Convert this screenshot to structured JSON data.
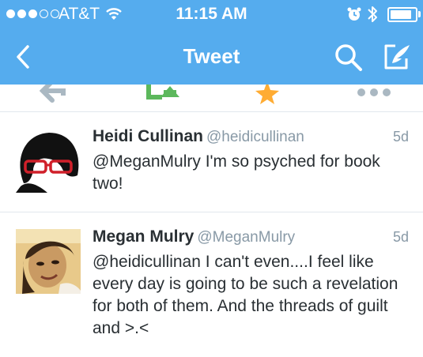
{
  "status_bar": {
    "carrier": "AT&T",
    "time": "11:15 AM",
    "signal_bars_filled": 3,
    "signal_bars_total": 5,
    "battery_level": 0.85
  },
  "nav": {
    "title": "Tweet",
    "back_icon": "chevron-left-icon",
    "search_icon": "search-icon",
    "compose_icon": "compose-tweet-icon"
  },
  "actions": [
    "reply-icon",
    "retweet-icon",
    "favorite-icon",
    "more-icon"
  ],
  "colors": {
    "accent": "#55acee",
    "retweet": "#5cb85c",
    "favorite": "#ffac33",
    "name": "#292f33",
    "meta": "#8899a6"
  },
  "tweets": [
    {
      "name": "Heidi Cullinan",
      "handle": "@heidicullinan",
      "time": "5d",
      "text": "@MeganMulry I'm so psyched for book two!"
    },
    {
      "name": "Megan Mulry",
      "handle": "@MeganMulry",
      "time": "5d",
      "text": "@heidicullinan I can't even....I feel like every day is going to be such a revelation for both of them. And the threads of guilt and >.<"
    }
  ]
}
